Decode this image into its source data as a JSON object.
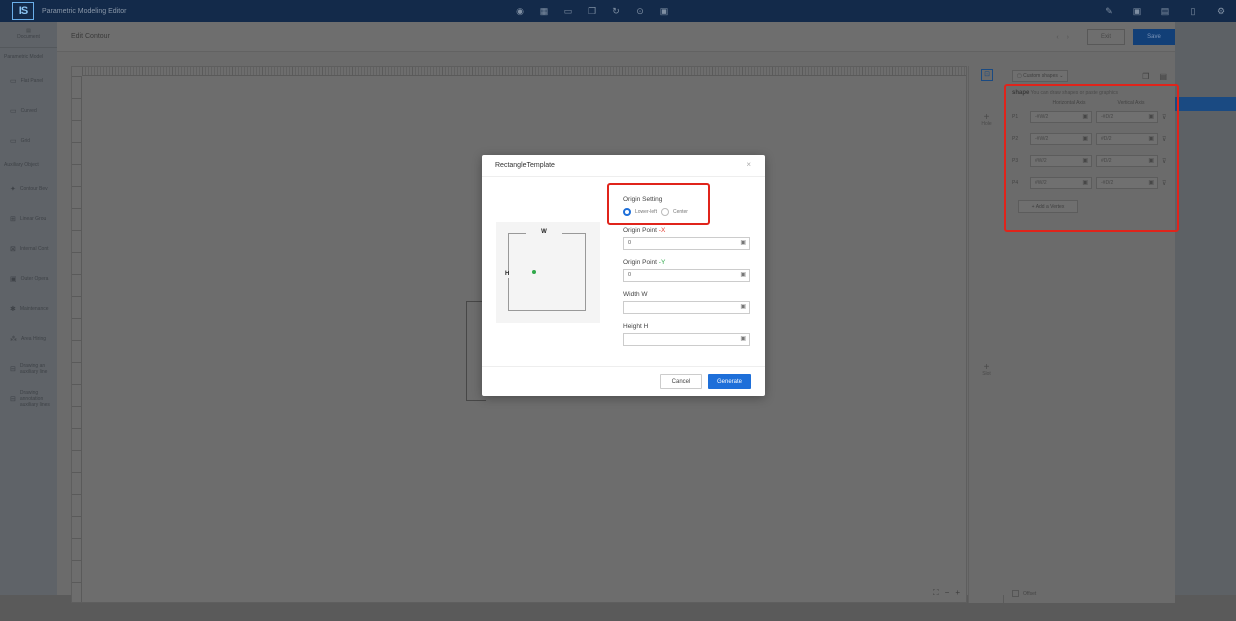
{
  "app": {
    "title": "Parametric Modeling Editor",
    "logo": "IS"
  },
  "leftnav": {
    "document": "Document",
    "section_model": "Parametric Model",
    "items": [
      {
        "label": "Flat Panel"
      },
      {
        "label": "Curved"
      },
      {
        "label": "Grid"
      }
    ],
    "section_aux": "Auxiliary Object",
    "aux_items": [
      {
        "label": "Contour Bev"
      },
      {
        "label": "Linear Grou"
      },
      {
        "label": "Internal Cont"
      },
      {
        "label": "Outer Opera"
      },
      {
        "label": "Maintenance"
      },
      {
        "label": "Area Hiring"
      },
      {
        "label": "Drawing an auxiliary line"
      },
      {
        "label": "Drawing annotation auxiliary lines"
      }
    ]
  },
  "editor": {
    "title": "Edit Contour",
    "exit_label": "Exit",
    "save_label": "Save",
    "tools": {
      "hole": "Hole",
      "slot": "Slot"
    },
    "offset_label": "Offset"
  },
  "props": {
    "shape_dropdown": "Custom shapes",
    "shape_title": "shape",
    "shape_hint": "You can draw shapes or paste graphics",
    "axis_h": "Horizontal Axis",
    "axis_v": "Vertical Axis",
    "points": [
      {
        "label": "P1",
        "h": "-#W/2",
        "v": "-#D/2"
      },
      {
        "label": "P2",
        "h": "-#W/2",
        "v": "#D/2"
      },
      {
        "label": "P3",
        "h": "#W/2",
        "v": "#D/2"
      },
      {
        "label": "P4",
        "h": "#W/2",
        "v": "-#D/2"
      }
    ],
    "add_vertex": "+ Add a Vertex"
  },
  "dialog": {
    "title": "RectangleTemplate",
    "close": "×",
    "preview": {
      "w": "W",
      "h": "H"
    },
    "origin_setting": "Origin Setting",
    "radio_lower_left": "Lower-left",
    "radio_center": "Center",
    "origin_x_label": "Origin Point ",
    "origin_x_axis": "-X",
    "origin_x_value": "0",
    "origin_y_label": "Origin Point ",
    "origin_y_axis": "-Y",
    "origin_y_value": "0",
    "width_label": "Width W",
    "width_value": "",
    "height_label": "Height H",
    "height_value": "",
    "cancel_label": "Cancel",
    "generate_label": "Generate"
  },
  "colors": {
    "primary": "#1e6fd9",
    "highlight": "#e0241b",
    "green": "#2fa84a"
  }
}
